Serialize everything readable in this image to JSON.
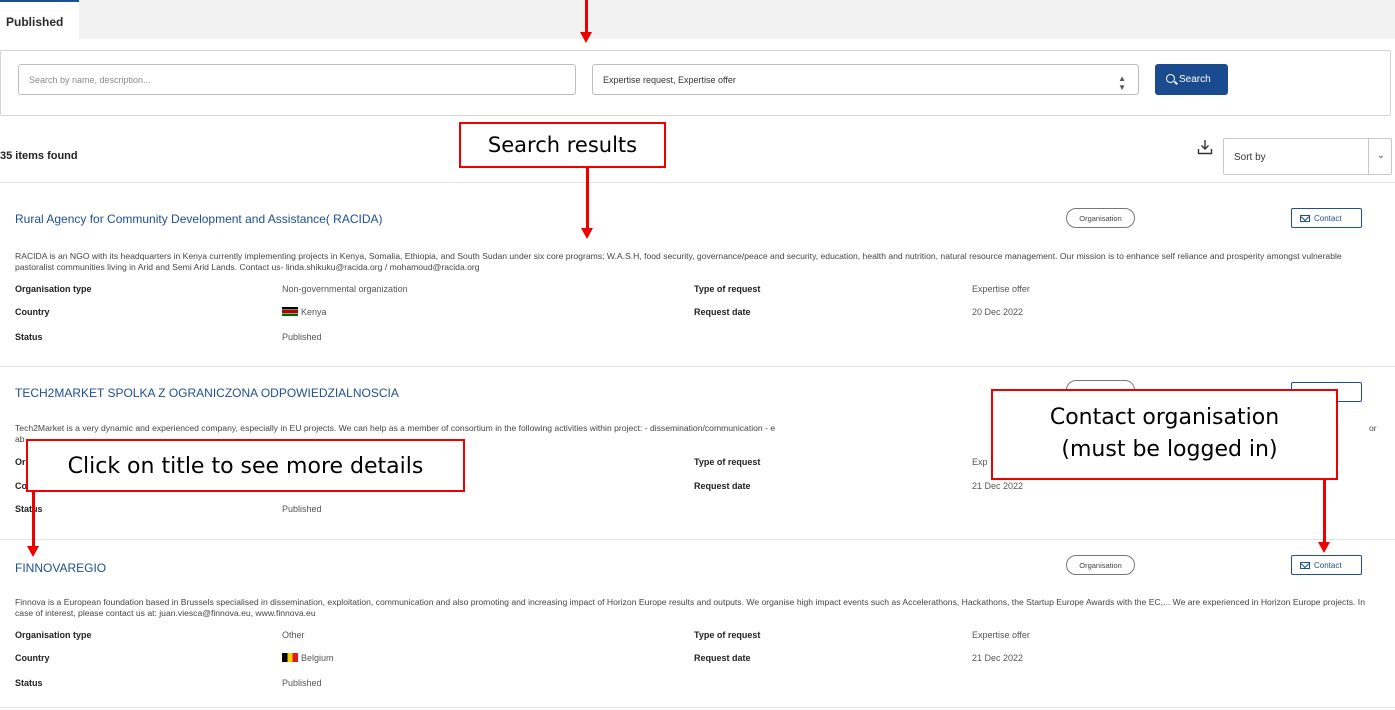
{
  "tabs": [
    {
      "label": "Published"
    }
  ],
  "search": {
    "placeholder": "Search by name, description...",
    "filter_value": "Expertise request, Expertise offer",
    "button_label": "Search"
  },
  "results": {
    "count_label": "35 items found",
    "sort_label": "Sort by"
  },
  "items": [
    {
      "title": "Rural Agency for Community Development and Assistance( RACIDA)",
      "badge": "Organisation",
      "contact_label": "Contact",
      "description": "RACIDA is an NGO with its headquarters in Kenya currently implementing projects in Kenya, Somalia, Ethiopia, and South Sudan under six core programs; W.A.S.H, food security, governance/peace and security, education, health and nutrition, natural resource management. Our mission is to enhance self reliance and prosperity amongst vulnerable pastoralist communities living in Arid and Semi Arid Lands. Contact us- linda.shikuku@racida.org / mohamoud@racida.org",
      "labels": {
        "org_type": "Organisation type",
        "country": "Country",
        "status": "Status",
        "request_type": "Type of request",
        "request_date": "Request date"
      },
      "org_type": "Non-governmental organization",
      "country": "Kenya",
      "status": "Published",
      "request_type": "Expertise offer",
      "request_date": "20 Dec 2022"
    },
    {
      "title": "TECH2MARKET SPOLKA Z OGRANICZONA ODPOWIEDZIALNOSCIA",
      "contact_label": "ntact",
      "description": "Tech2Market is a very dynamic and experienced company, especially in EU projects. We can help as a member of consortium in the following activities within project: - dissemination/communication - e",
      "description_tail": "or",
      "description_line2": "ab",
      "labels": {
        "org_type": "Or",
        "country": "Co",
        "status": "Status",
        "request_type": "Type of request",
        "request_date": "Request date"
      },
      "status": "Published",
      "request_type": "Exp",
      "request_date": "21 Dec 2022"
    },
    {
      "title": "FINNOVAREGIO",
      "badge": "Organisation",
      "contact_label": "Contact",
      "description": "Finnova is a European foundation based in Brussels specialised in dissemination, exploitation, communication and also promoting and increasing impact of Horizon Europe results and outputs. We organise high impact events such as Accelerathons, Hackathons, the Startup Europe Awards with the EC,... We are experienced in Horizon Europe projects. In case of interest, please contact us at: juan.viesca@finnova.eu, www.finnova.eu",
      "labels": {
        "org_type": "Organisation type",
        "country": "Country",
        "status": "Status",
        "request_type": "Type of request",
        "request_date": "Request date"
      },
      "org_type": "Other",
      "country": "Belgium",
      "status": "Published",
      "request_type": "Expertise offer",
      "request_date": "21 Dec 2022"
    }
  ],
  "annotations": {
    "search_results": "Search results",
    "click_title": "Click on title to see more details",
    "contact_line1": "Contact organisation",
    "contact_line2": "(must be logged in)"
  },
  "colors": {
    "accent": "#1d4f91",
    "annotation": "#e00000"
  }
}
